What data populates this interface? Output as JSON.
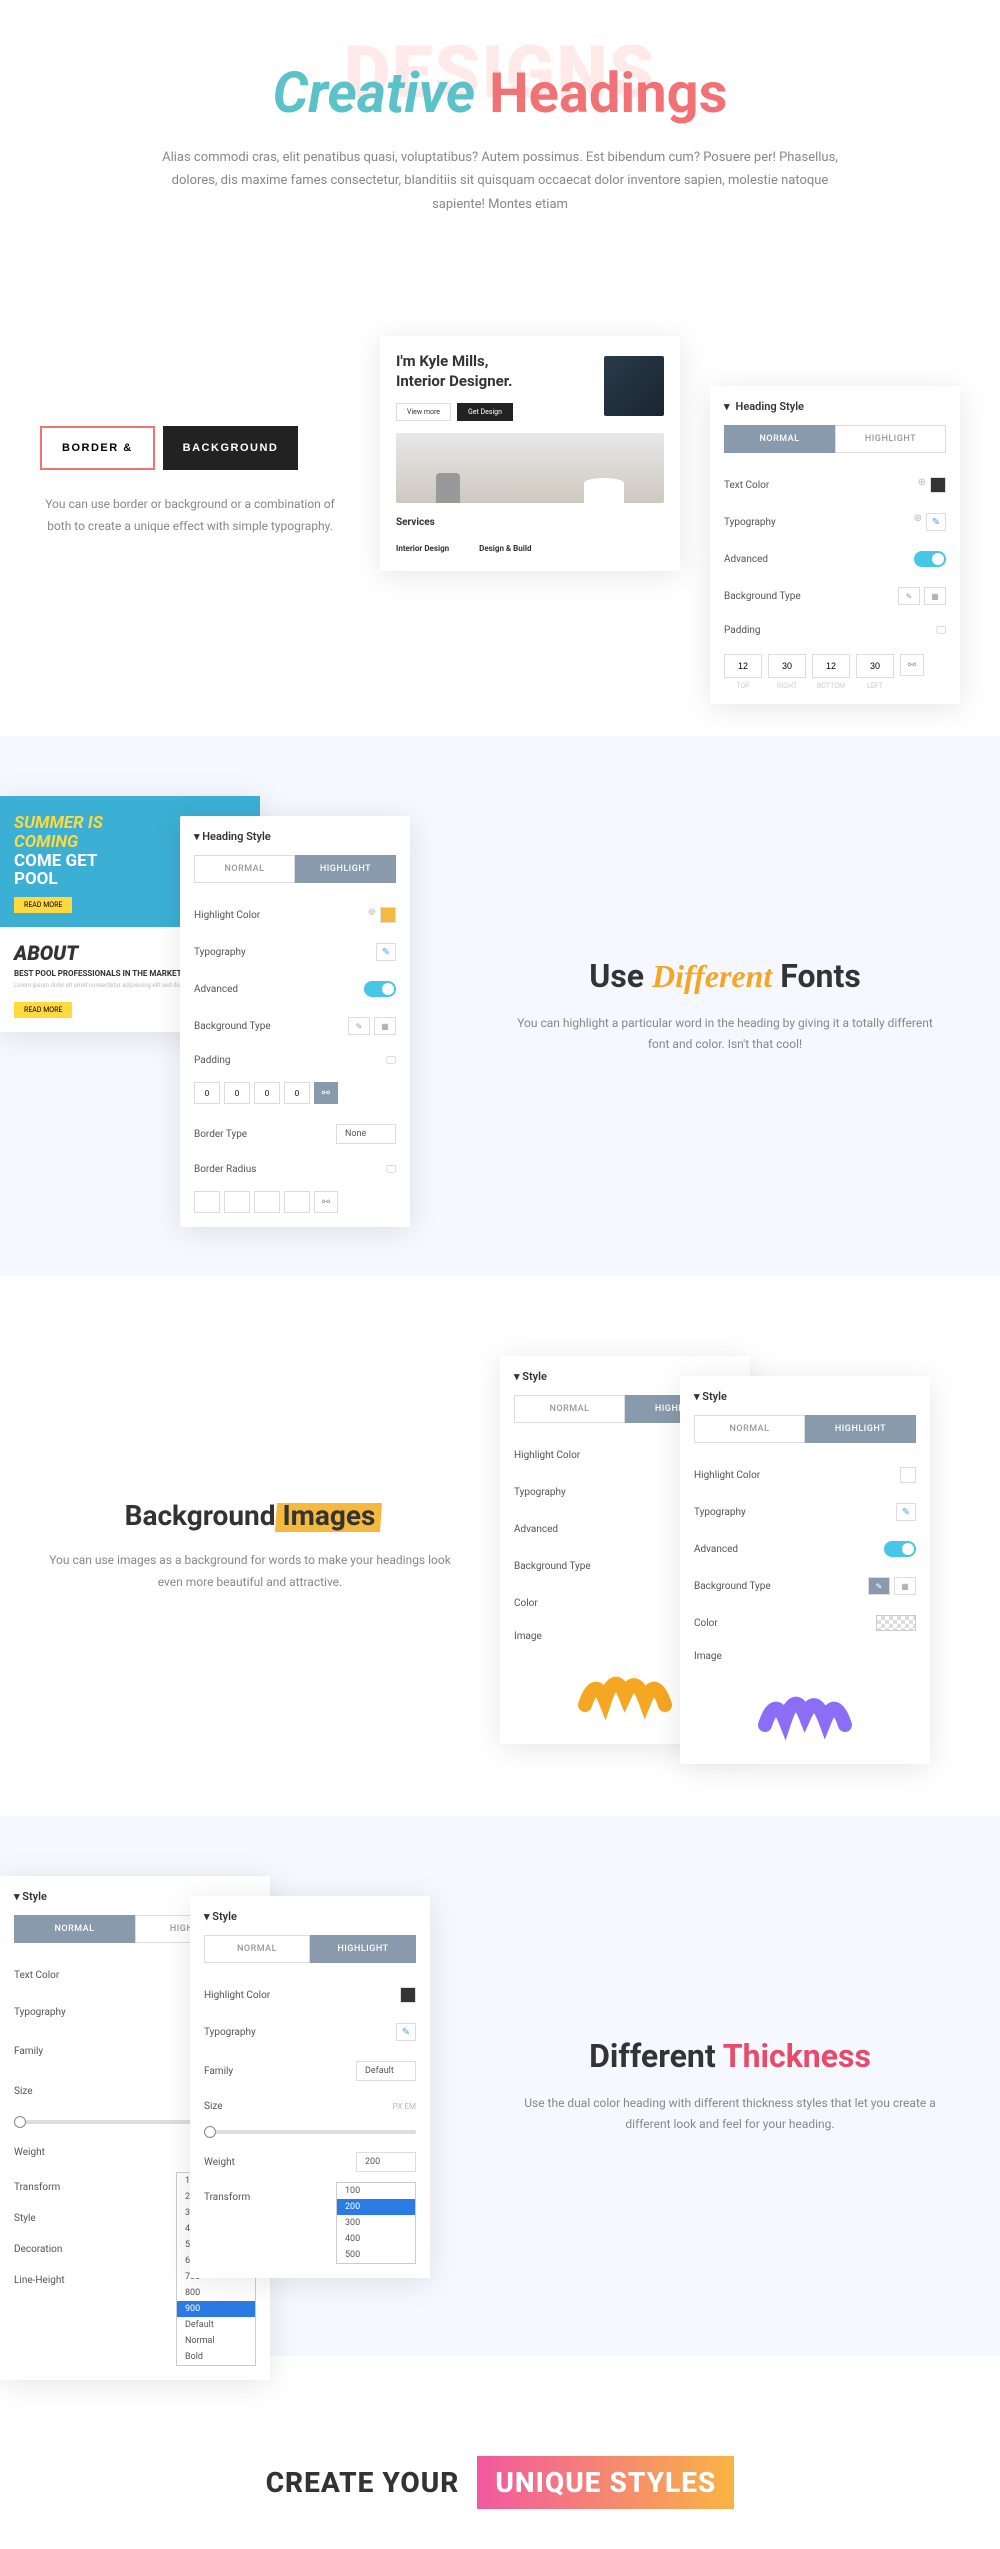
{
  "hero": {
    "bg_text": "DESIGNS",
    "title_teal": "Creative",
    "title_coral": "Headings",
    "desc": "Alias commodi cras, elit penatibus quasi, voluptatibus? Autem possimus. Est bibendum cum? Posuere per! Phasellus, dolores, dis maxime fames consectetur, blanditiis sit quisquam occaecat dolor inventore sapien, molestie natoque sapiente! Montes etiam"
  },
  "section1": {
    "btn_border": "BORDER &",
    "btn_bg": "BACKGROUND",
    "desc": "You can use border or background or a combination of both to create a unique effect with simple typography.",
    "kyle": {
      "pre": "",
      "title": "I'm Kyle Mills,\nInterior Designer.",
      "btn1": "View more",
      "btn2": "Get Design",
      "services_title": "Services",
      "svc1": "Interior Design",
      "svc2": "Design & Build"
    },
    "hs": {
      "title": "Heading Style",
      "tab_normal": "NORMAL",
      "tab_highlight": "HIGHLIGHT",
      "text_color": "Text Color",
      "typography": "Typography",
      "advanced": "Advanced",
      "bg_type": "Background Type",
      "padding": "Padding",
      "pad_vals": [
        "12",
        "30",
        "12",
        "30"
      ],
      "pad_lbls": [
        "TOP",
        "RIGHT",
        "BOTTOM",
        "LEFT"
      ]
    }
  },
  "section2": {
    "title_pre": "Use",
    "title_highlight": "Different",
    "title_post": "Fonts",
    "desc": "You can highlight a particular word in the heading by giving it a totally different font and color. Isn't that cool!",
    "pool": {
      "line1": "SUMMER IS",
      "line2": "COMING",
      "line3": "COME GET",
      "line4": "POOL",
      "btn": "READ MORE",
      "about": "ABOUT",
      "sub": "BEST POOL PROFESSIONALS IN THE MARKET"
    },
    "hs": {
      "title": "Heading Style",
      "tab_normal": "NORMAL",
      "tab_highlight": "HIGHLIGHT",
      "hl_color": "Highlight Color",
      "typography": "Typography",
      "advanced": "Advanced",
      "bg_type": "Background Type",
      "padding": "Padding",
      "pad_vals": [
        "0",
        "0",
        "0",
        "0"
      ],
      "border_type": "Border Type",
      "border_none": "None",
      "border_radius": "Border Radius"
    }
  },
  "section3": {
    "title_pre": "Background",
    "title_highlight": "Images",
    "desc": "You can use images as a background for words to make your headings look even more beautiful and attractive.",
    "style": {
      "title": "Style",
      "tab_normal": "NORMAL",
      "tab_highlight": "HIGHLIGHT",
      "hl_color": "Highlight Color",
      "typography": "Typography",
      "advanced": "Advanced",
      "bg_type": "Background Type",
      "color": "Color",
      "image": "Image"
    }
  },
  "section4": {
    "title_pre": "Different",
    "title_red": "Thickness",
    "desc": "Use the dual color heading with different thickness styles that let you create a different look and feel for your heading.",
    "style": {
      "title": "Style",
      "tab_normal": "NORMAL",
      "tab_highlight": "HIGHLIGHT",
      "text_color": "Text Color",
      "typography": "Typography",
      "family": "Family",
      "family_val": "Default",
      "size": "Size",
      "size_val": "1",
      "weight": "Weight",
      "weight_val": "900",
      "transform": "Transform",
      "style_lbl": "Style",
      "decoration": "Decoration",
      "line_height": "Line-Height",
      "wopts": [
        "100",
        "200",
        "300",
        "400",
        "500",
        "600",
        "700",
        "800",
        "900",
        "Default",
        "Normal",
        "Bold"
      ],
      "hl_color": "Highlight Color",
      "w2opts": [
        "100",
        "200",
        "300",
        "400",
        "500"
      ]
    }
  },
  "footer": {
    "title_pre": "CREATE YOUR",
    "title_grad": "UNIQUE STYLES"
  }
}
